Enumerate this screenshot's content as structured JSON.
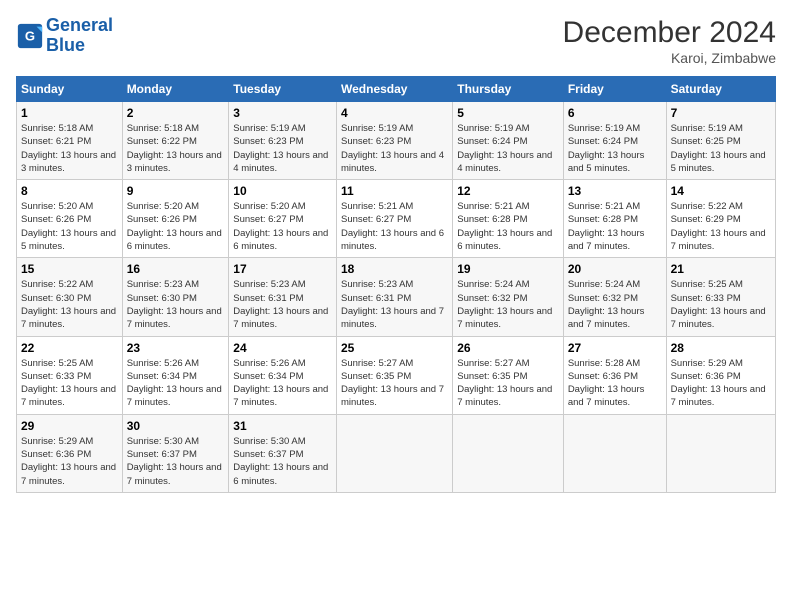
{
  "logo": {
    "line1": "General",
    "line2": "Blue"
  },
  "title": "December 2024",
  "location": "Karoi, Zimbabwe",
  "days_of_week": [
    "Sunday",
    "Monday",
    "Tuesday",
    "Wednesday",
    "Thursday",
    "Friday",
    "Saturday"
  ],
  "weeks": [
    [
      {
        "day": "1",
        "sunrise": "5:18 AM",
        "sunset": "6:21 PM",
        "daylight": "13 hours and 3 minutes."
      },
      {
        "day": "2",
        "sunrise": "5:18 AM",
        "sunset": "6:22 PM",
        "daylight": "13 hours and 3 minutes."
      },
      {
        "day": "3",
        "sunrise": "5:19 AM",
        "sunset": "6:23 PM",
        "daylight": "13 hours and 4 minutes."
      },
      {
        "day": "4",
        "sunrise": "5:19 AM",
        "sunset": "6:23 PM",
        "daylight": "13 hours and 4 minutes."
      },
      {
        "day": "5",
        "sunrise": "5:19 AM",
        "sunset": "6:24 PM",
        "daylight": "13 hours and 4 minutes."
      },
      {
        "day": "6",
        "sunrise": "5:19 AM",
        "sunset": "6:24 PM",
        "daylight": "13 hours and 5 minutes."
      },
      {
        "day": "7",
        "sunrise": "5:19 AM",
        "sunset": "6:25 PM",
        "daylight": "13 hours and 5 minutes."
      }
    ],
    [
      {
        "day": "8",
        "sunrise": "5:20 AM",
        "sunset": "6:26 PM",
        "daylight": "13 hours and 5 minutes."
      },
      {
        "day": "9",
        "sunrise": "5:20 AM",
        "sunset": "6:26 PM",
        "daylight": "13 hours and 6 minutes."
      },
      {
        "day": "10",
        "sunrise": "5:20 AM",
        "sunset": "6:27 PM",
        "daylight": "13 hours and 6 minutes."
      },
      {
        "day": "11",
        "sunrise": "5:21 AM",
        "sunset": "6:27 PM",
        "daylight": "13 hours and 6 minutes."
      },
      {
        "day": "12",
        "sunrise": "5:21 AM",
        "sunset": "6:28 PM",
        "daylight": "13 hours and 6 minutes."
      },
      {
        "day": "13",
        "sunrise": "5:21 AM",
        "sunset": "6:28 PM",
        "daylight": "13 hours and 7 minutes."
      },
      {
        "day": "14",
        "sunrise": "5:22 AM",
        "sunset": "6:29 PM",
        "daylight": "13 hours and 7 minutes."
      }
    ],
    [
      {
        "day": "15",
        "sunrise": "5:22 AM",
        "sunset": "6:30 PM",
        "daylight": "13 hours and 7 minutes."
      },
      {
        "day": "16",
        "sunrise": "5:23 AM",
        "sunset": "6:30 PM",
        "daylight": "13 hours and 7 minutes."
      },
      {
        "day": "17",
        "sunrise": "5:23 AM",
        "sunset": "6:31 PM",
        "daylight": "13 hours and 7 minutes."
      },
      {
        "day": "18",
        "sunrise": "5:23 AM",
        "sunset": "6:31 PM",
        "daylight": "13 hours and 7 minutes."
      },
      {
        "day": "19",
        "sunrise": "5:24 AM",
        "sunset": "6:32 PM",
        "daylight": "13 hours and 7 minutes."
      },
      {
        "day": "20",
        "sunrise": "5:24 AM",
        "sunset": "6:32 PM",
        "daylight": "13 hours and 7 minutes."
      },
      {
        "day": "21",
        "sunrise": "5:25 AM",
        "sunset": "6:33 PM",
        "daylight": "13 hours and 7 minutes."
      }
    ],
    [
      {
        "day": "22",
        "sunrise": "5:25 AM",
        "sunset": "6:33 PM",
        "daylight": "13 hours and 7 minutes."
      },
      {
        "day": "23",
        "sunrise": "5:26 AM",
        "sunset": "6:34 PM",
        "daylight": "13 hours and 7 minutes."
      },
      {
        "day": "24",
        "sunrise": "5:26 AM",
        "sunset": "6:34 PM",
        "daylight": "13 hours and 7 minutes."
      },
      {
        "day": "25",
        "sunrise": "5:27 AM",
        "sunset": "6:35 PM",
        "daylight": "13 hours and 7 minutes."
      },
      {
        "day": "26",
        "sunrise": "5:27 AM",
        "sunset": "6:35 PM",
        "daylight": "13 hours and 7 minutes."
      },
      {
        "day": "27",
        "sunrise": "5:28 AM",
        "sunset": "6:36 PM",
        "daylight": "13 hours and 7 minutes."
      },
      {
        "day": "28",
        "sunrise": "5:29 AM",
        "sunset": "6:36 PM",
        "daylight": "13 hours and 7 minutes."
      }
    ],
    [
      {
        "day": "29",
        "sunrise": "5:29 AM",
        "sunset": "6:36 PM",
        "daylight": "13 hours and 7 minutes."
      },
      {
        "day": "30",
        "sunrise": "5:30 AM",
        "sunset": "6:37 PM",
        "daylight": "13 hours and 7 minutes."
      },
      {
        "day": "31",
        "sunrise": "5:30 AM",
        "sunset": "6:37 PM",
        "daylight": "13 hours and 6 minutes."
      },
      null,
      null,
      null,
      null
    ]
  ]
}
